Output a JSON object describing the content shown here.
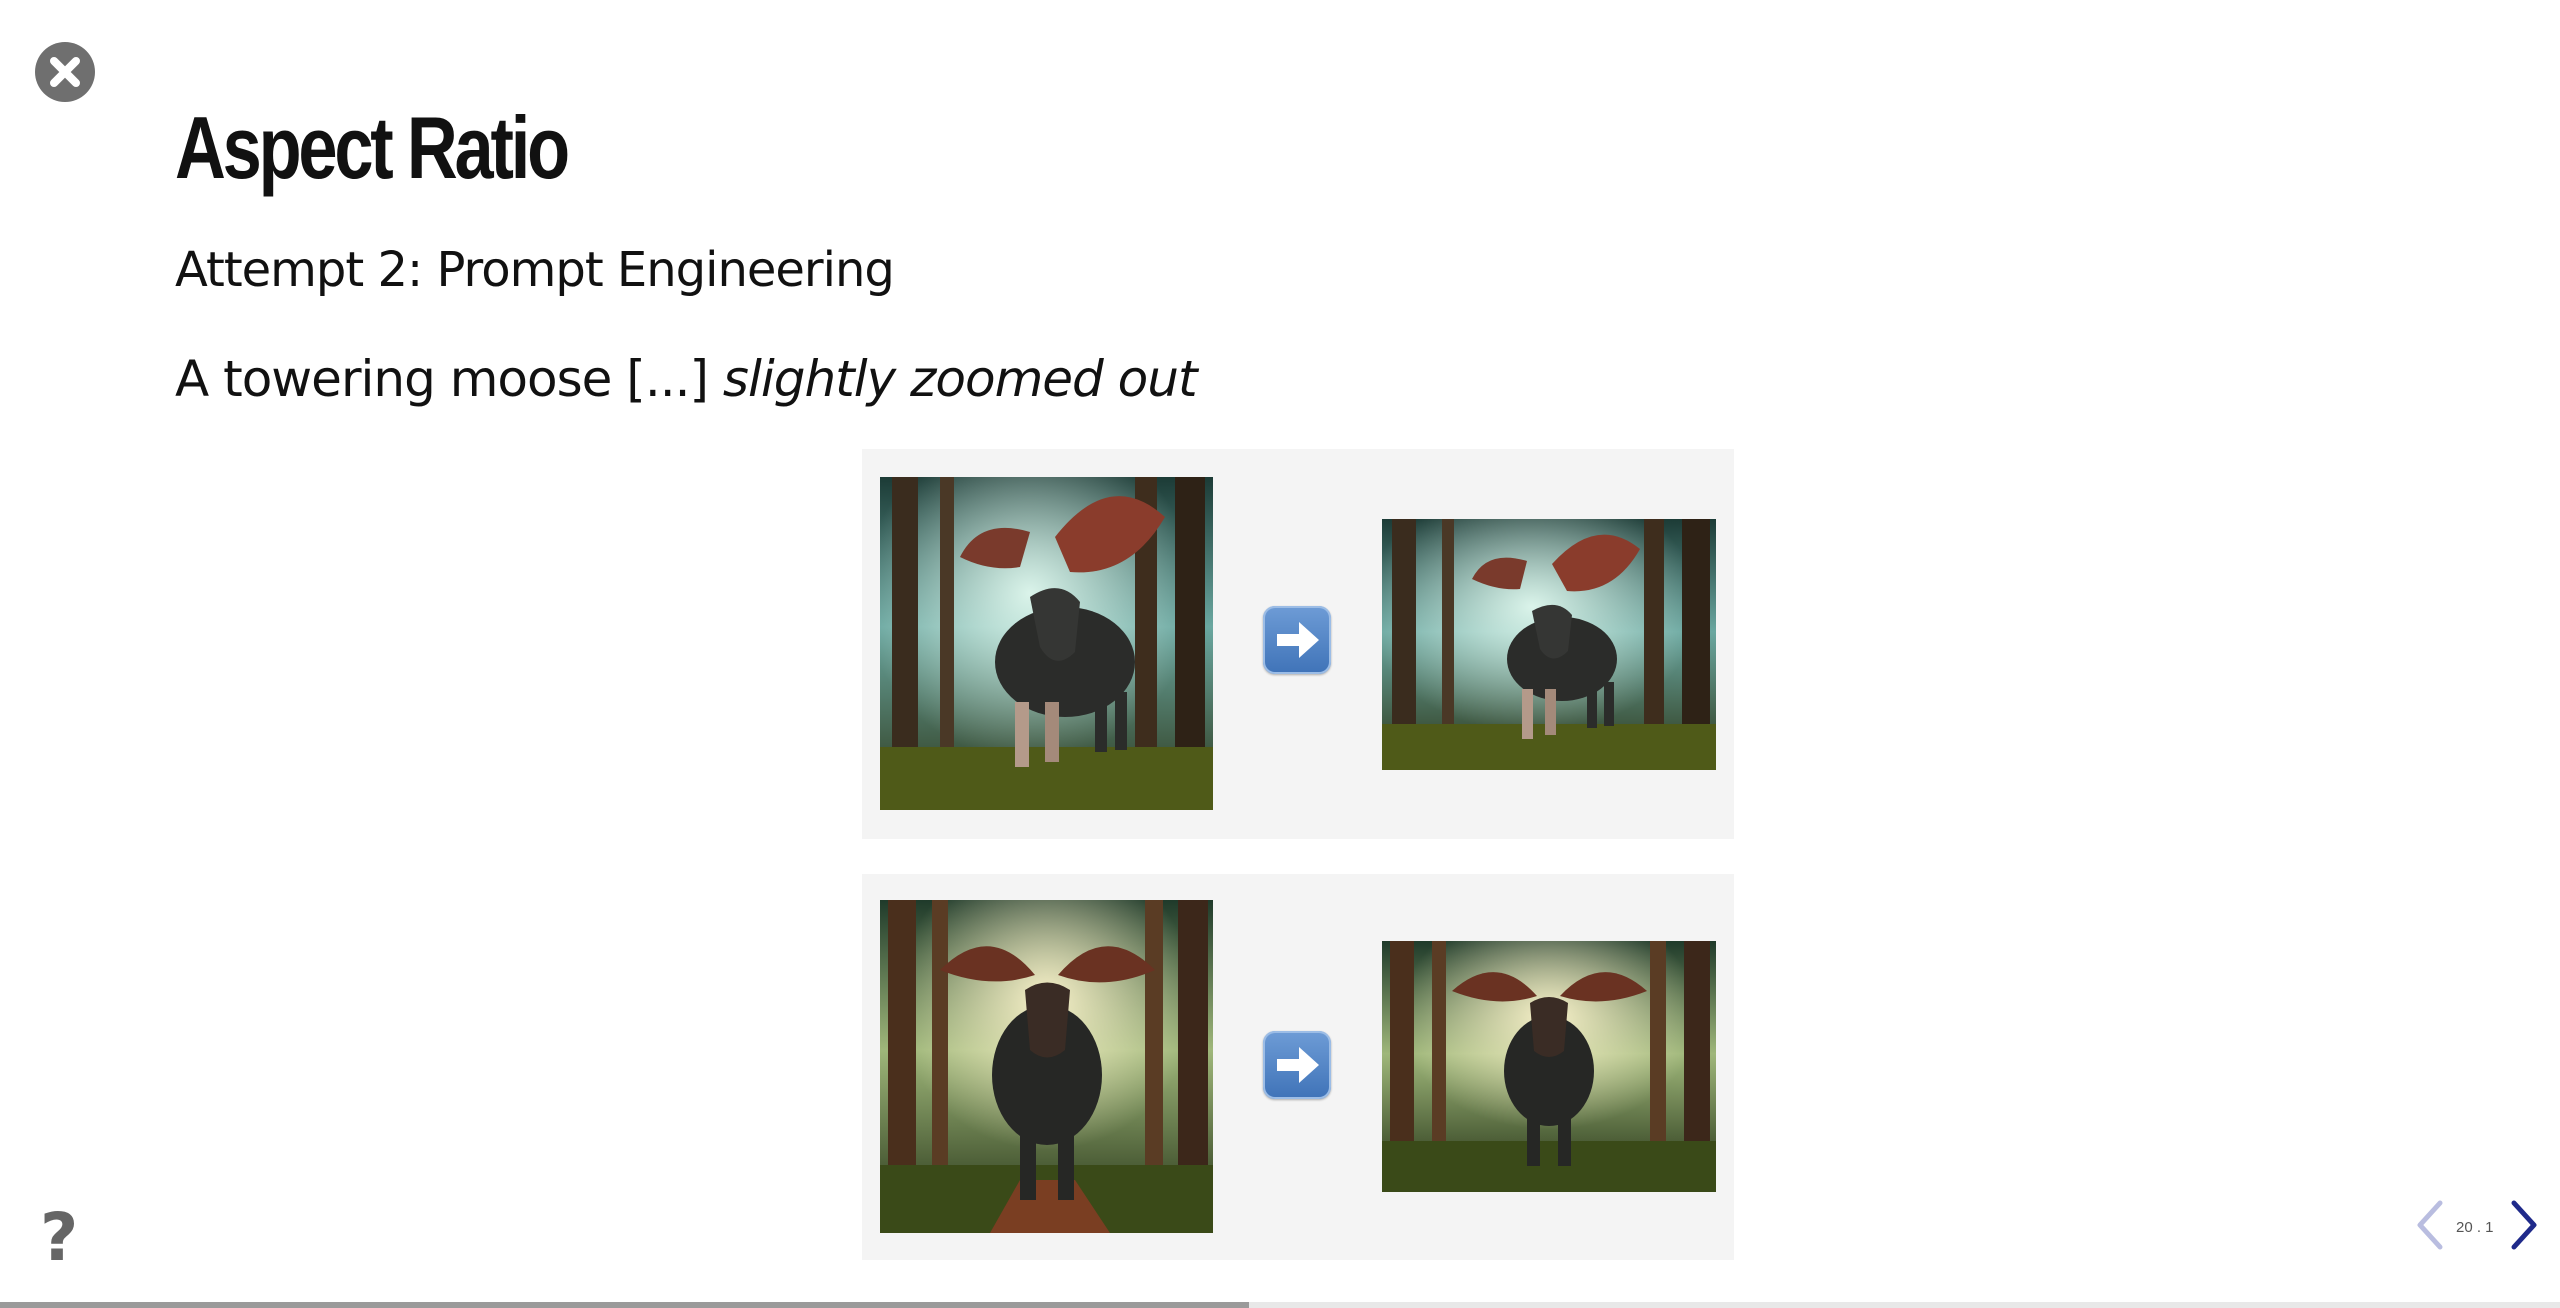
{
  "slide": {
    "title": "Aspect Ratio",
    "subtitle": "Attempt 2: Prompt Engineering",
    "prompt_text": "A towering moose [...] ",
    "prompt_emphasis": "slightly zoomed out"
  },
  "comparisons": [
    {
      "source_image": "moose-forest-side-view-square",
      "result_image": "moose-forest-side-view-landscape"
    },
    {
      "source_image": "moose-forest-front-view-square",
      "result_image": "moose-forest-front-view-landscape"
    }
  ],
  "navigation": {
    "slide_number": "20 . 1",
    "progress": 0.488,
    "accent_color": "#1f2a8a",
    "disabled_color": "#b9bde0"
  },
  "icons": {
    "close": "close-circle-icon",
    "help": "question-mark-icon",
    "arrow": "right-arrow-icon",
    "prev": "chevron-left-icon",
    "next": "chevron-right-icon"
  }
}
